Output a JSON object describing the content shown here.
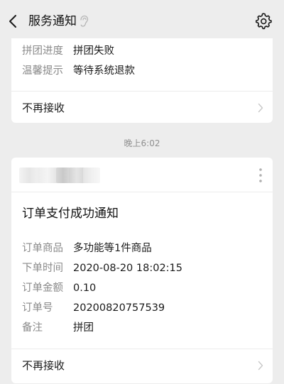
{
  "header": {
    "title": "服务通知"
  },
  "card1": {
    "rows": [
      {
        "key": "拼团进度",
        "value": "拼团失败"
      },
      {
        "key": "温馨提示",
        "value": "等待系统退款"
      }
    ],
    "footer_label": "不再接收"
  },
  "timestamp": "晚上6:02",
  "card2": {
    "title": "订单支付成功通知",
    "rows": [
      {
        "key": "订单商品",
        "value": "多功能等1件商品"
      },
      {
        "key": "下单时间",
        "value": "2020-08-20 18:02:15"
      },
      {
        "key": "订单金额",
        "value": "0.10"
      },
      {
        "key": "订单号",
        "value": "20200820757539"
      },
      {
        "key": "备注",
        "value": "拼团"
      }
    ],
    "footer_label": "不再接收"
  },
  "colors": {
    "background": "#ededed",
    "card": "#ffffff",
    "label": "#8a8a8a",
    "text": "#1a1a1a"
  }
}
